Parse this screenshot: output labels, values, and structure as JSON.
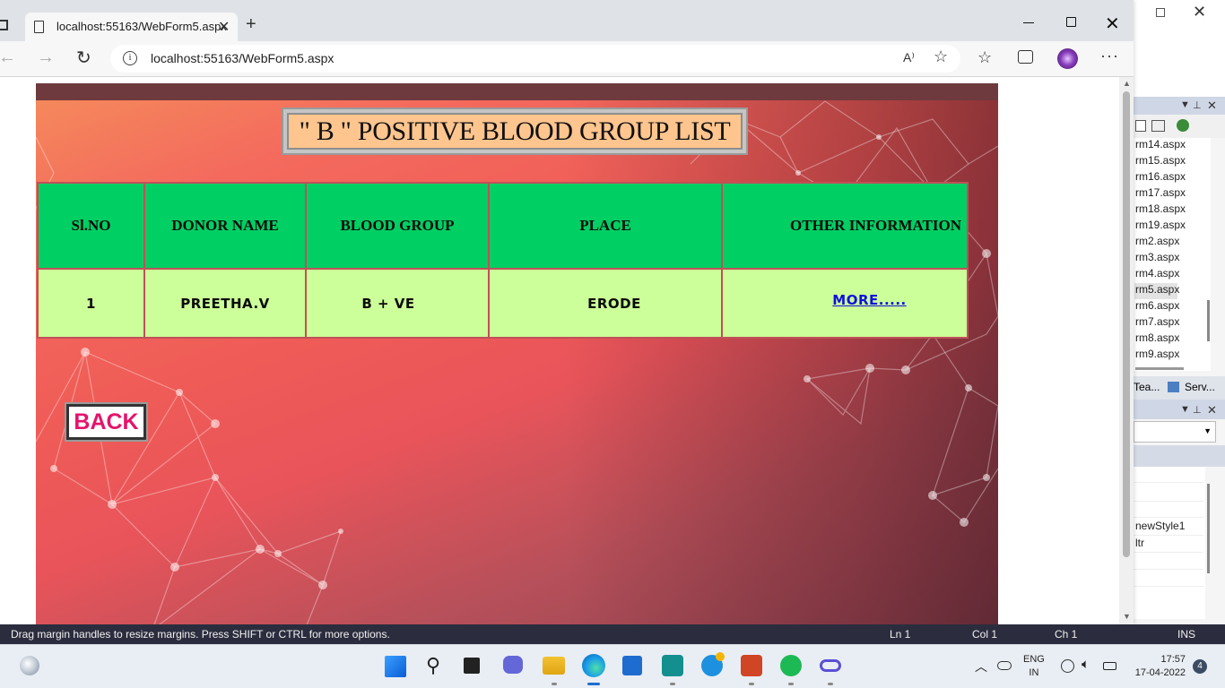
{
  "browser": {
    "tab_title": "localhost:55163/WebForm5.aspx",
    "url": "localhost:55163/WebForm5.aspx",
    "read_aloud": "A⁾"
  },
  "page": {
    "title": "\" B \" POSITIVE BLOOD GROUP LIST",
    "columns": [
      "Sl.NO",
      "DONOR NAME",
      "BLOOD GROUP",
      "PLACE",
      "OTHER INFORMATION"
    ],
    "rows": [
      {
        "slno": "1",
        "donor": "PREETHA.V",
        "group": "B + VE",
        "place": "ERODE",
        "info_link": "MORE....."
      }
    ],
    "back_label": "BACK",
    "colors": {
      "header_bg": "#00cf63",
      "row_bg": "#ccff99",
      "title_bg": "#ffc58e",
      "back_text": "#e4146b",
      "link": "#1010dd"
    }
  },
  "vs": {
    "files": [
      "rm14.aspx",
      "rm15.aspx",
      "rm16.aspx",
      "rm17.aspx",
      "rm18.aspx",
      "rm19.aspx",
      "rm2.aspx",
      "rm3.aspx",
      "rm4.aspx",
      "rm5.aspx",
      "rm6.aspx",
      "rm7.aspx",
      "rm8.aspx",
      "rm9.aspx"
    ],
    "selected_file": "rm5.aspx",
    "tabs": [
      "Tea...",
      "Serv..."
    ],
    "props": [
      "newStyle1",
      "ltr"
    ],
    "status": {
      "message": "Drag margin handles to resize margins. Press SHIFT or CTRL for more options.",
      "ln": "Ln 1",
      "col": "Col 1",
      "ch": "Ch 1",
      "ins": "INS"
    }
  },
  "taskbar": {
    "lang_top": "ENG",
    "lang_bottom": "IN",
    "time": "17:57",
    "date": "17-04-2022",
    "notifications": "4",
    "icons": [
      "start-icon",
      "search-icon",
      "task-view-icon",
      "chat-icon",
      "file-explorer-icon",
      "edge-icon",
      "store-icon",
      "visual-studio-icon",
      "help-icon",
      "powerpoint-icon",
      "spotify-icon",
      "infinity-icon"
    ]
  }
}
